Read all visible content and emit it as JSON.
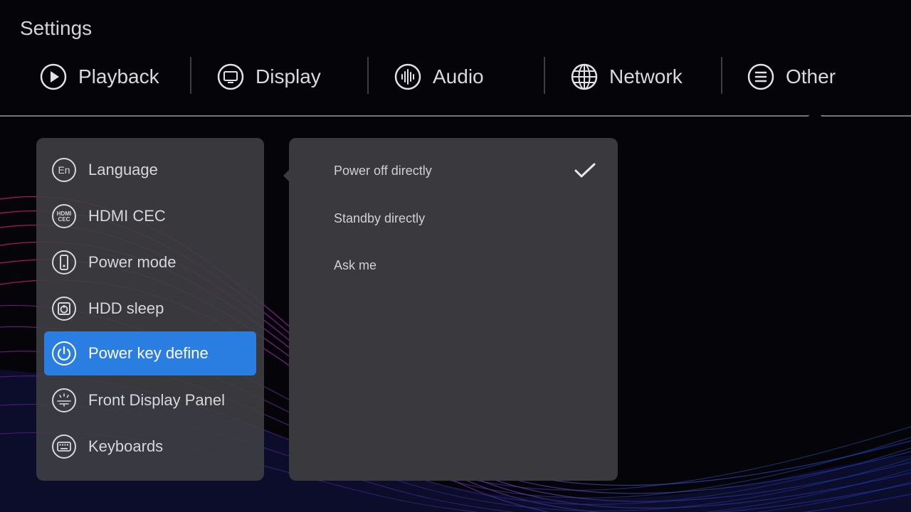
{
  "app": {
    "title": "Settings"
  },
  "tabs": [
    {
      "label": "Playback",
      "icon": "play-circle-icon"
    },
    {
      "label": "Display",
      "icon": "monitor-icon"
    },
    {
      "label": "Audio",
      "icon": "audio-waveform-icon"
    },
    {
      "label": "Network",
      "icon": "globe-icon"
    },
    {
      "label": "Other",
      "icon": "list-icon",
      "active": true
    }
  ],
  "menu": {
    "items": [
      {
        "label": "Language",
        "icon": "language-icon",
        "icon_text": "En"
      },
      {
        "label": "HDMI CEC",
        "icon": "hdmi-cec-icon",
        "icon_text": [
          "HDMI",
          "CEC"
        ]
      },
      {
        "label": "Power mode",
        "icon": "phone-icon"
      },
      {
        "label": "HDD sleep",
        "icon": "hdd-icon"
      },
      {
        "label": "Power key define",
        "icon": "power-icon",
        "selected": true
      },
      {
        "label": "Front Display Panel",
        "icon": "front-panel-icon"
      },
      {
        "label": "Keyboards",
        "icon": "keyboard-icon"
      }
    ]
  },
  "options": {
    "items": [
      {
        "label": "Power off directly",
        "checked": true
      },
      {
        "label": "Standby directly",
        "checked": false
      },
      {
        "label": "Ask me",
        "checked": false
      }
    ]
  },
  "colors": {
    "accent": "#2a7de1",
    "background": "#050509",
    "panel": "#3e3e44",
    "text": "#d6d6dc"
  }
}
